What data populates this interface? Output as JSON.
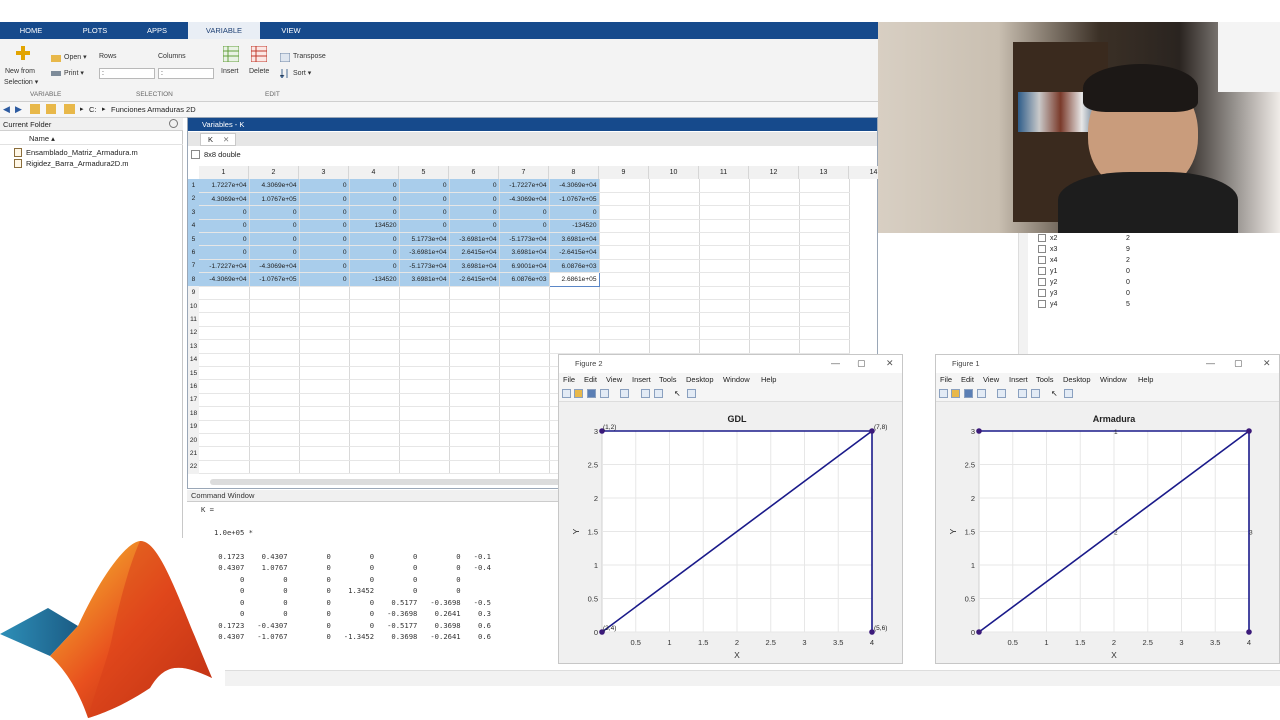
{
  "tabs": [
    "HOME",
    "PLOTS",
    "APPS",
    "VARIABLE",
    "VIEW"
  ],
  "ribbon": {
    "new_from_selection": [
      "New from",
      "Selection ▾"
    ],
    "open": "Open ▾",
    "print": "Print ▾",
    "rows": "Rows",
    "columns": "Columns",
    "rows_value": ":",
    "columns_value": ":",
    "insert": "Insert",
    "delete": "Delete",
    "transpose": "Transpose",
    "sort": "Sort ▾",
    "section_variable": "VARIABLE",
    "section_selection": "SELECTION",
    "section_edit": "EDIT"
  },
  "path": {
    "drive": "C:",
    "folder": "Funciones Armaduras 2D"
  },
  "current_folder": {
    "title": "Current Folder",
    "column": "Name ▴",
    "files": [
      "Ensamblado_Matriz_Armadura.m",
      "Rigidez_Barra_Armadura2D.m"
    ]
  },
  "variables": {
    "title": "Variables - K",
    "tab": "K",
    "info": "8x8 double",
    "columns": [
      "1",
      "2",
      "3",
      "4",
      "5",
      "6",
      "7",
      "8",
      "9",
      "10",
      "11",
      "12",
      "13",
      "14"
    ],
    "rows": [
      [
        "1.7227e+04",
        "4.3069e+04",
        "0",
        "0",
        "0",
        "0",
        "-1.7227e+04",
        "-4.3069e+04"
      ],
      [
        "4.3069e+04",
        "1.0767e+05",
        "0",
        "0",
        "0",
        "0",
        "-4.3069e+04",
        "-1.0767e+05"
      ],
      [
        "0",
        "0",
        "0",
        "0",
        "0",
        "0",
        "0",
        "0"
      ],
      [
        "0",
        "0",
        "0",
        "134520",
        "0",
        "0",
        "0",
        "-134520"
      ],
      [
        "0",
        "0",
        "0",
        "0",
        "5.1773e+04",
        "-3.6981e+04",
        "-5.1773e+04",
        "3.6981e+04"
      ],
      [
        "0",
        "0",
        "0",
        "0",
        "-3.6981e+04",
        "2.6415e+04",
        "3.6981e+04",
        "-2.6415e+04"
      ],
      [
        "-1.7227e+04",
        "-4.3069e+04",
        "0",
        "0",
        "-5.1773e+04",
        "3.6981e+04",
        "6.9001e+04",
        "6.0876e+03"
      ],
      [
        "-4.3069e+04",
        "-1.0767e+05",
        "0",
        "-134520",
        "3.6981e+04",
        "-2.6415e+04",
        "6.0876e+03",
        "2.6861e+05"
      ]
    ],
    "row_numbers": [
      "1",
      "2",
      "3",
      "4",
      "5",
      "6",
      "7",
      "8",
      "9",
      "10",
      "11",
      "12",
      "13",
      "14",
      "15",
      "16",
      "17",
      "18",
      "19",
      "20",
      "21",
      "22"
    ]
  },
  "command_window": {
    "title": "Command Window",
    "lines": [
      "K =",
      "",
      "   1.0e+05 *",
      "",
      "    0.1723    0.4307         0         0         0         0   -0.1",
      "    0.4307    1.0767         0         0         0         0   -0.4",
      "         0         0         0         0         0         0",
      "         0         0         0    1.3452         0         0",
      "         0         0         0         0    0.5177   -0.3698   -0.5",
      "         0         0         0         0   -0.3698    0.2641    0.3",
      "    0.1723   -0.4307         0         0   -0.5177    0.3698    0.6",
      "    0.4307   -1.0767         0   -1.3452    0.3698   -0.2641    0.6"
    ]
  },
  "workspace": [
    {
      "name": "x2",
      "value": "2"
    },
    {
      "name": "x3",
      "value": "9"
    },
    {
      "name": "x4",
      "value": "2"
    },
    {
      "name": "y1",
      "value": "0"
    },
    {
      "name": "y2",
      "value": "0"
    },
    {
      "name": "y3",
      "value": "0"
    },
    {
      "name": "y4",
      "value": "5"
    }
  ],
  "figure2": {
    "window_title": "Figure 2",
    "menu": [
      "File",
      "Edit",
      "View",
      "Insert",
      "Tools",
      "Desktop",
      "Window",
      "Help"
    ]
  },
  "figure1": {
    "window_title": "Figure 1",
    "menu": [
      "File",
      "Edit",
      "View",
      "Insert",
      "Tools",
      "Desktop",
      "Window",
      "Help"
    ]
  },
  "chart_data": [
    {
      "type": "line",
      "title": "GDL",
      "xlabel": "X",
      "ylabel": "Y",
      "xlim": [
        0,
        4
      ],
      "ylim": [
        0,
        3
      ],
      "xticks": [
        "0.5",
        "1",
        "1.5",
        "2",
        "2.5",
        "3",
        "3.5",
        "4"
      ],
      "yticks": [
        "0",
        "0.5",
        "1",
        "1.5",
        "2",
        "2.5",
        "3"
      ],
      "grid": true,
      "series": [
        {
          "x": [
            0,
            4
          ],
          "y": [
            3,
            3
          ]
        },
        {
          "x": [
            0,
            4
          ],
          "y": [
            0,
            3
          ]
        },
        {
          "x": [
            4,
            4
          ],
          "y": [
            3,
            0
          ]
        }
      ],
      "points": [
        {
          "x": 0,
          "y": 3,
          "label": "(1,2)"
        },
        {
          "x": 4,
          "y": 3,
          "label": "(7,8)"
        },
        {
          "x": 0,
          "y": 0,
          "label": "(3,4)"
        },
        {
          "x": 4,
          "y": 0,
          "label": "(5,6)"
        }
      ]
    },
    {
      "type": "line",
      "title": "Armadura",
      "xlabel": "X",
      "ylabel": "Y",
      "xlim": [
        0,
        4
      ],
      "ylim": [
        0,
        3
      ],
      "xticks": [
        "0.5",
        "1",
        "1.5",
        "2",
        "2.5",
        "3",
        "3.5",
        "4"
      ],
      "yticks": [
        "0",
        "0.5",
        "1",
        "1.5",
        "2",
        "2.5",
        "3"
      ],
      "grid": true,
      "series": [
        {
          "x": [
            0,
            4
          ],
          "y": [
            3,
            3
          ]
        },
        {
          "x": [
            0,
            4
          ],
          "y": [
            0,
            3
          ]
        },
        {
          "x": [
            4,
            4
          ],
          "y": [
            3,
            0
          ]
        }
      ],
      "annotations": [
        {
          "x": 2,
          "y": 3,
          "label": "1"
        },
        {
          "x": 2,
          "y": 1.5,
          "label": "2"
        },
        {
          "x": 4,
          "y": 1.5,
          "label": "3"
        }
      ],
      "points": [
        {
          "x": 0,
          "y": 3
        },
        {
          "x": 4,
          "y": 3
        },
        {
          "x": 0,
          "y": 0
        },
        {
          "x": 4,
          "y": 0
        }
      ]
    }
  ],
  "colors": {
    "titlebar": "#164a8c",
    "selection": "#a9cdeb",
    "plot_line": "#1a1a8a",
    "marker": "#3b1a7a"
  }
}
